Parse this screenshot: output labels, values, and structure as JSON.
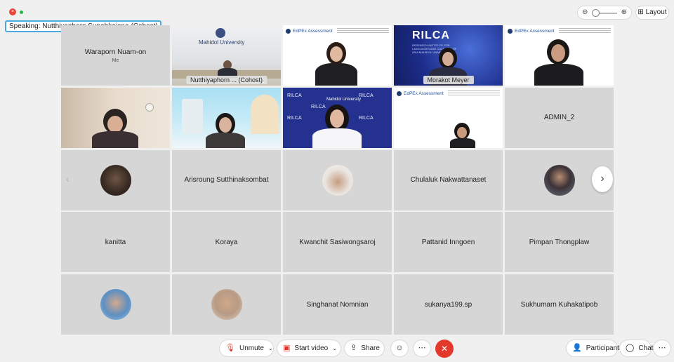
{
  "speaking_banner": "Speaking: Nutthiyaphorn Supabkajana (Cohost), Mor...",
  "layout_label": "Layout",
  "tiles": [
    {
      "name": "Waraporn Nuam-on",
      "sub": "Me"
    },
    {
      "label": "Nutthiyaphorn ...  (Cohost)",
      "sign": "Mahidol University"
    },
    {
      "logo": "EdPEx Assessment"
    },
    {
      "label": "Morakot Meyer",
      "banner": "RILCA",
      "banner_sub": "RESEARCH INSTITUTE FOR LANGUAGES AND CULTURES OF ASIA MAHIDOL UNIVERSITY"
    },
    {
      "logo": "EdPEx Assessment"
    },
    {},
    {},
    {
      "banner": "RILCA",
      "sign": "Mahidol University"
    },
    {
      "logo": "EdPEx Assessment"
    },
    {
      "name": "ADMIN_2"
    },
    {},
    {
      "name": "Arisroung Sutthinaksombat"
    },
    {},
    {
      "name": "Chulaluk Nakwattanaset"
    },
    {},
    {
      "name": "kanitta"
    },
    {
      "name": "Koraya"
    },
    {
      "name": "Kwanchit Sasiwongsaroj"
    },
    {
      "name": "Pattanid Inngoen"
    },
    {
      "name": "Pimpan Thongplaw"
    },
    {},
    {},
    {
      "name": "Singhanat Nomnian"
    },
    {
      "name": "sukanya199.sp"
    },
    {
      "name": "Sukhumarn Kuhakatipob"
    }
  ],
  "toolbar": {
    "unmute": "Unmute",
    "start_video": "Start video",
    "share": "Share",
    "participants": "Participants",
    "chat": "Chat"
  }
}
